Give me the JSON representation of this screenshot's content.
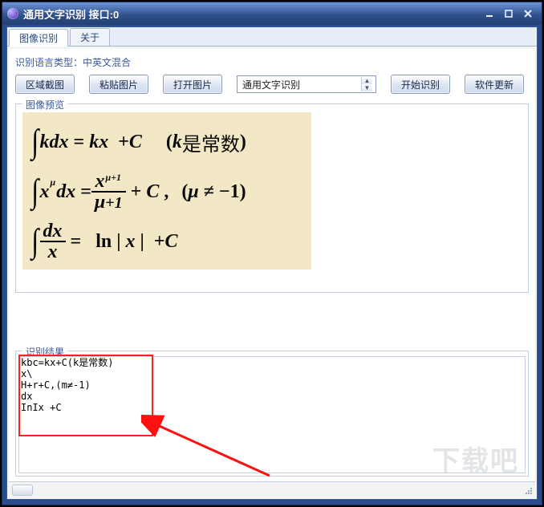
{
  "window": {
    "title": "通用文字识别 接口:0"
  },
  "tabs": {
    "items": [
      {
        "label": "图像识别"
      },
      {
        "label": "关于"
      }
    ]
  },
  "lang_row": {
    "label": "识别语言类型：",
    "value": "中英文混合"
  },
  "toolbar": {
    "area_screenshot": "区域截图",
    "paste_image": "粘贴图片",
    "open_image": "打开图片",
    "recognize_type": "通用文字识别",
    "start_recognize": "开始识别",
    "software_update": "软件更新"
  },
  "groups": {
    "preview": "图像预览",
    "results": "识别结果"
  },
  "results_text": "kbc=kx+C(k是常数)\nx\\\nH+r+C,(m≠-1)\ndx\nInIx +C\n",
  "watermark": "下载吧",
  "annotations": {
    "highlight_box": true,
    "arrow": true
  },
  "math_source": {
    "lines": [
      "∫kdx = kx + C   (k是常数)",
      "∫x^μ dx = x^(μ+1)/(μ+1) + C ,  (μ ≠ -1)",
      "∫ dx/x = ln|x| + C"
    ]
  }
}
